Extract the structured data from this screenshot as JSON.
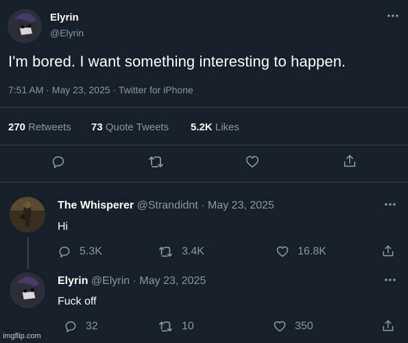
{
  "main_tweet": {
    "display_name": "Elyrin",
    "handle": "@Elyrin",
    "text": "I'm bored. I want something interesting to happen.",
    "meta": "7:51 AM · May 23, 2025 · Twitter for iPhone",
    "stats": {
      "retweets_count": "270",
      "retweets_label": "Retweets",
      "quotes_count": "73",
      "quotes_label": "Quote Tweets",
      "likes_count": "5.2K",
      "likes_label": "Likes"
    }
  },
  "replies": [
    {
      "display_name": "The Whisperer",
      "handle_date": "@Strandidnt · May 23, 2025",
      "text": "Hi",
      "replies": "5.3K",
      "retweets": "3.4K",
      "likes": "16.8K"
    },
    {
      "display_name": "Elyrin",
      "handle_date": "@Elyrin · May 23, 2025",
      "text": "Fuck off",
      "replies": "32",
      "retweets": "10",
      "likes": "350"
    }
  ],
  "watermark": "imgflip.com",
  "colors": {
    "background": "#15202b",
    "text": "#ffffff",
    "muted": "#8b98a5",
    "divider": "#38444d"
  },
  "icons": [
    "more-icon",
    "reply-icon",
    "retweet-icon",
    "like-icon",
    "share-icon"
  ]
}
